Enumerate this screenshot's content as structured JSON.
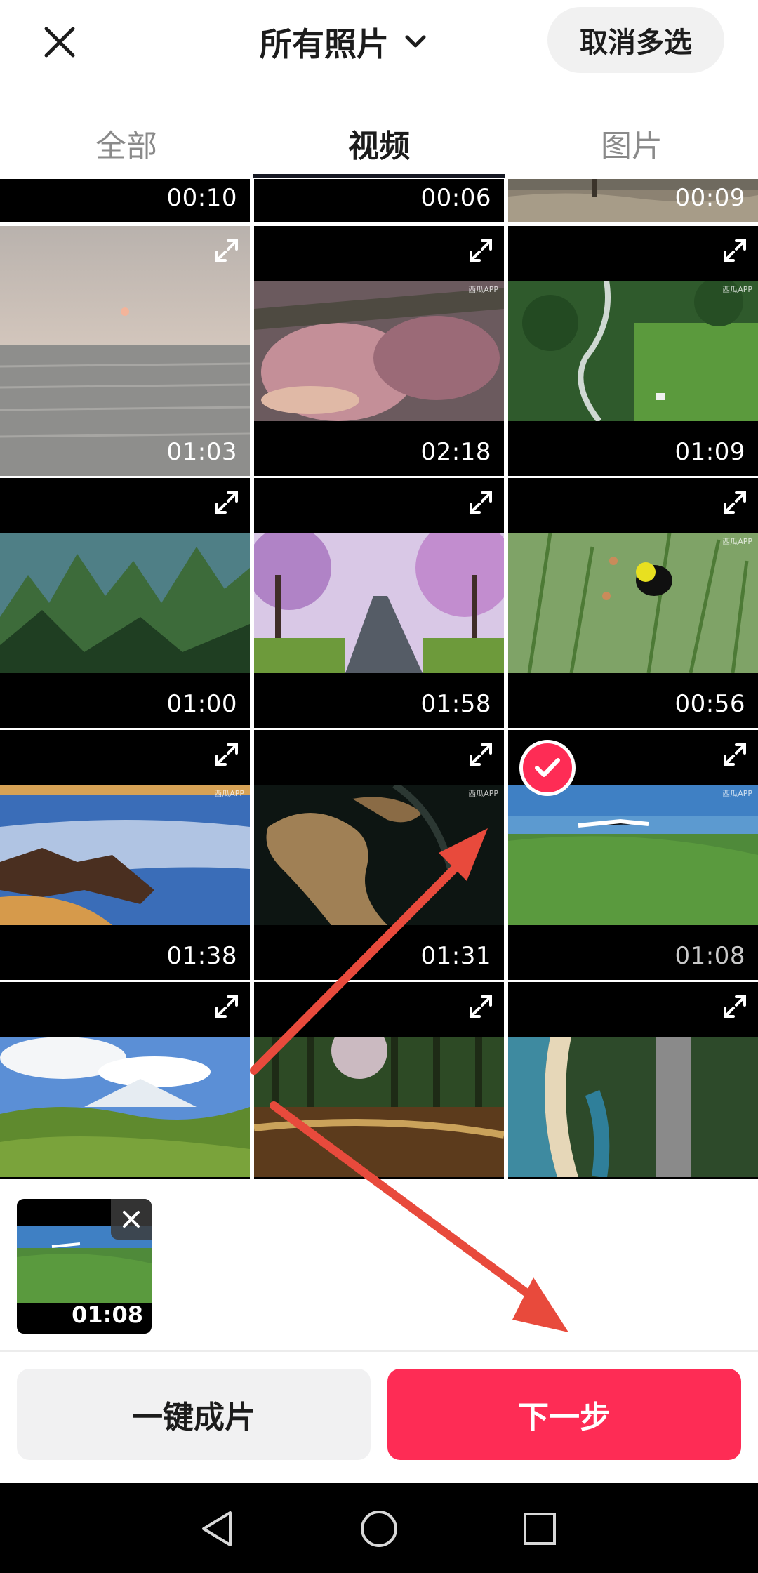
{
  "header": {
    "close_icon": "close-icon",
    "title": "所有照片",
    "title_chevron_icon": "chevron-down-icon",
    "cancel_label": "取消多选"
  },
  "tabs": [
    {
      "label": "全部",
      "active": false
    },
    {
      "label": "视频",
      "active": true
    },
    {
      "label": "图片",
      "active": false
    }
  ],
  "grid": {
    "expand_icon": "expand-icon",
    "watermark": "西瓜APP",
    "partial_row": [
      {
        "duration": "00:10",
        "scene": "dark"
      },
      {
        "duration": "00:06",
        "scene": "dark"
      },
      {
        "duration": "00:09",
        "scene": "beach-top"
      }
    ],
    "rows": [
      [
        {
          "duration": "01:03",
          "scene": "sea-sunset",
          "selected": false
        },
        {
          "duration": "02:18",
          "scene": "pink-closeup",
          "selected": false
        },
        {
          "duration": "01:09",
          "scene": "forest-river",
          "selected": false
        }
      ],
      [
        {
          "duration": "01:00",
          "scene": "karst-mountains",
          "selected": false
        },
        {
          "duration": "01:58",
          "scene": "cherry-blossom-road",
          "selected": false
        },
        {
          "duration": "00:56",
          "scene": "bird-reeds",
          "selected": false
        }
      ],
      [
        {
          "duration": "01:38",
          "scene": "rocky-beach",
          "selected": false
        },
        {
          "duration": "01:31",
          "scene": "coral-sculpture",
          "selected": false
        },
        {
          "duration": "01:08",
          "scene": "green-cliffs",
          "selected": true
        }
      ],
      [
        {
          "duration": "",
          "scene": "mountain-meadow",
          "selected": false
        },
        {
          "duration": "",
          "scene": "sunlit-forest",
          "selected": false
        },
        {
          "duration": "",
          "scene": "coast-aerial",
          "selected": false
        }
      ]
    ]
  },
  "tray": {
    "items": [
      {
        "duration": "01:08",
        "scene": "green-cliffs"
      }
    ],
    "remove_icon": "close-icon"
  },
  "actions": {
    "one_click_label": "一键成片",
    "next_label": "下一步"
  },
  "navbar": {
    "back_icon": "back-triangle-icon",
    "home_icon": "home-circle-icon",
    "recents_icon": "recents-square-icon"
  },
  "colors": {
    "accent": "#fe2c55",
    "annotation_arrow": "#e84a3c",
    "tab_indicator": "#161823"
  }
}
